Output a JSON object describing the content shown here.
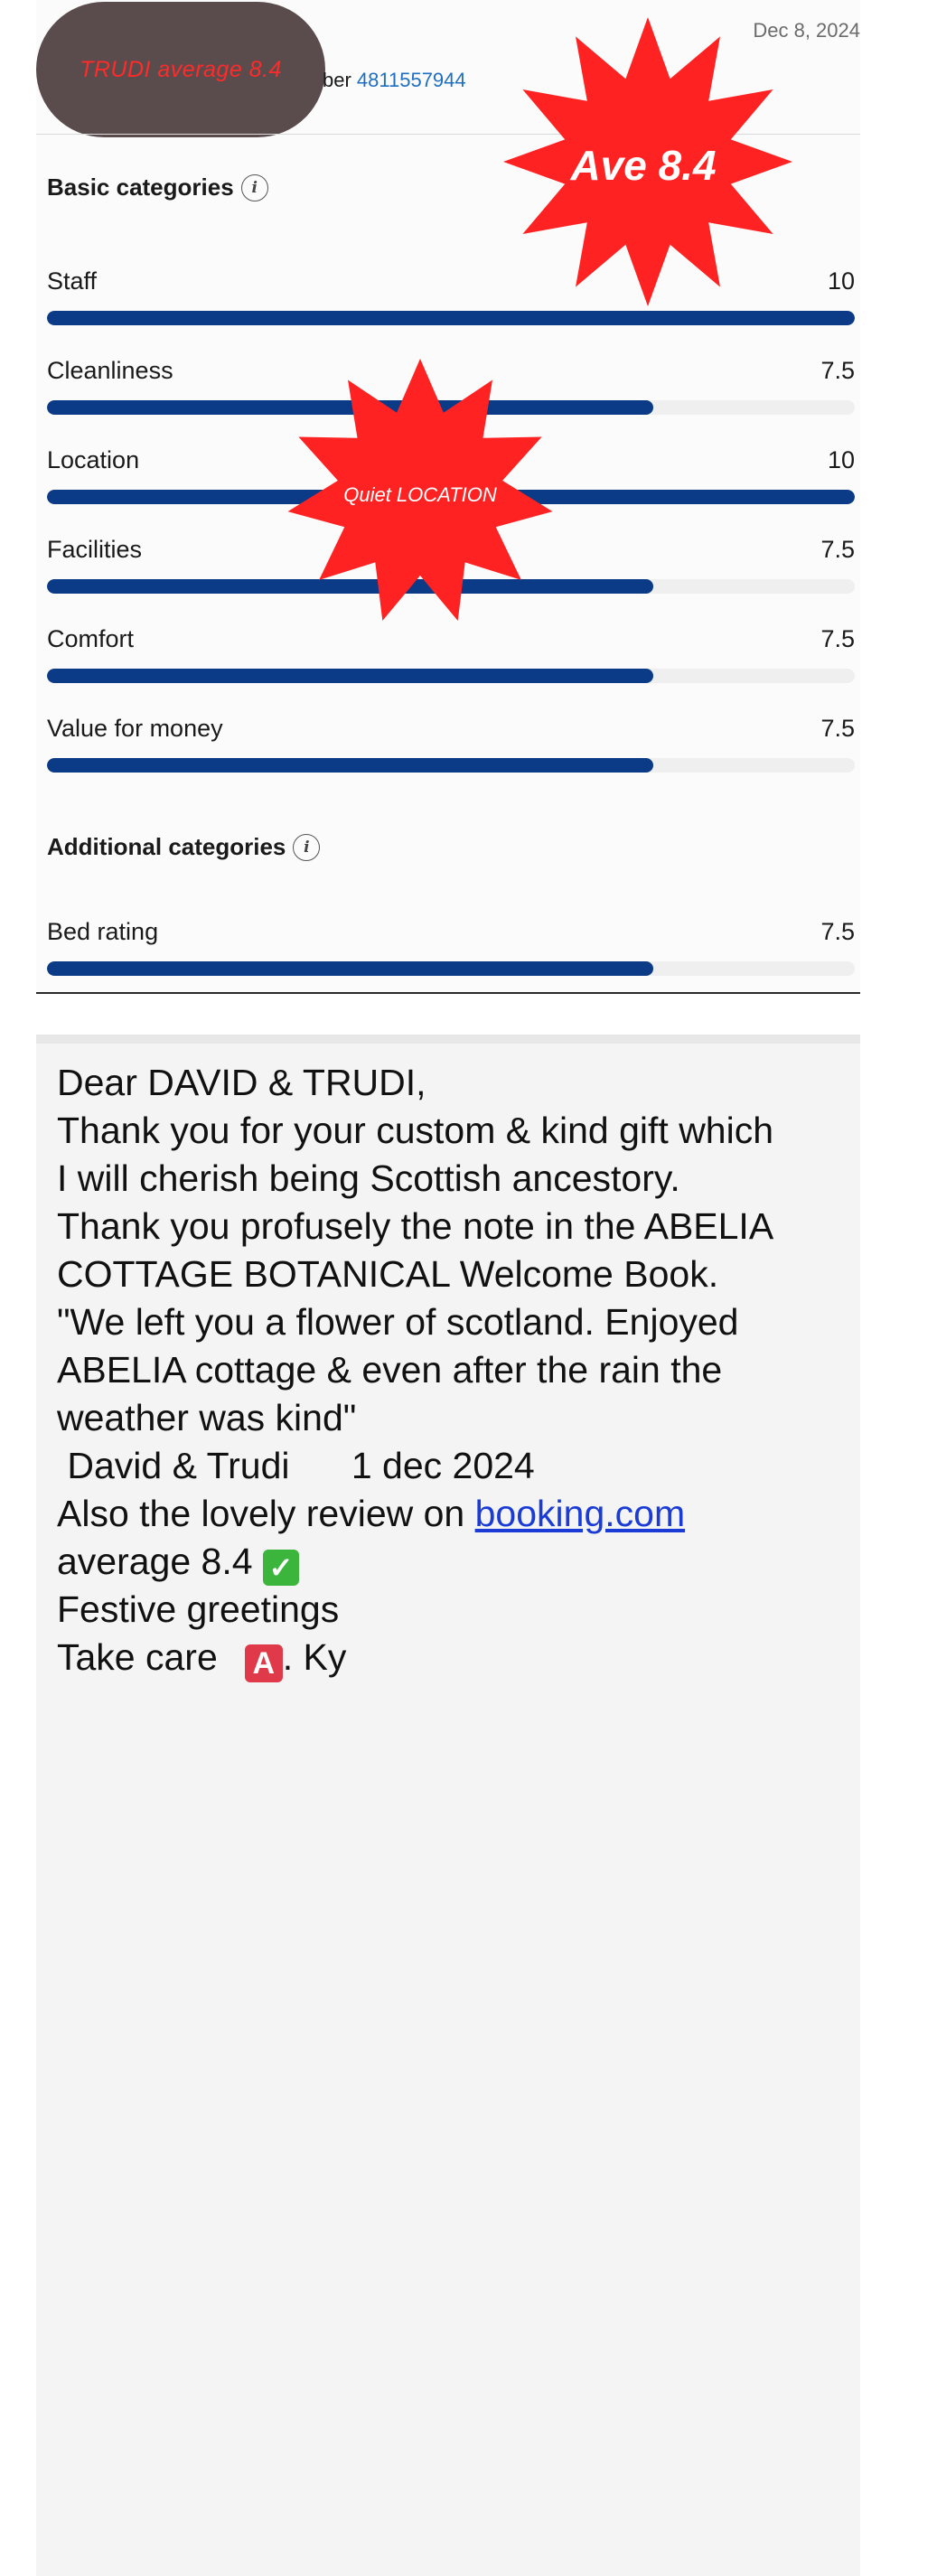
{
  "header": {
    "date": "Dec 8, 2024",
    "ref_prefix": "ber",
    "ref_number": "4811557944",
    "pill_text": "TRUDI average 8.4",
    "star_big_text": "Ave 8.4",
    "star_small_text": "Quiet LOCATION"
  },
  "basic": {
    "title": "Basic categories",
    "items": [
      {
        "label": "Staff",
        "value": "10",
        "fraction": 1.0
      },
      {
        "label": "Cleanliness",
        "value": "7.5",
        "fraction": 0.75
      },
      {
        "label": "Location",
        "value": "10",
        "fraction": 1.0
      },
      {
        "label": "Facilities",
        "value": "7.5",
        "fraction": 0.75
      },
      {
        "label": "Comfort",
        "value": "7.5",
        "fraction": 0.75
      },
      {
        "label": "Value for money",
        "value": "7.5",
        "fraction": 0.75
      }
    ]
  },
  "additional": {
    "title": "Additional categories",
    "items": [
      {
        "label": "Bed rating",
        "value": "7.5",
        "fraction": 0.75
      }
    ]
  },
  "message": {
    "line1": "Dear DAVID & TRUDI,",
    "line2": "Thank you for your custom & kind gift which",
    "line3": "I will cherish being Scottish ancestory.",
    "line4": "Thank you profusely the note in the ABELIA",
    "line5": "COTTAGE BOTANICAL Welcome Book.",
    "line6": "\"We left you a flower of scotland. Enjoyed",
    "line7": "ABELIA cottage & even after the rain the",
    "line8": "weather was kind\"",
    "line9": " David & Trudi      1 dec 2024",
    "line10_prefix": "Also the lovely review on ",
    "line10_link": "booking.com",
    "line11": "average 8.4",
    "line12": "Festive greetings",
    "line13_prefix": "Take care",
    "line13_box": "A",
    "line13_suffix": ". Ky"
  },
  "colors": {
    "bar_fill": "#0b3a86",
    "bar_track": "#efefef",
    "star_red": "#ff2222",
    "link_blue": "#1a3bd6"
  }
}
